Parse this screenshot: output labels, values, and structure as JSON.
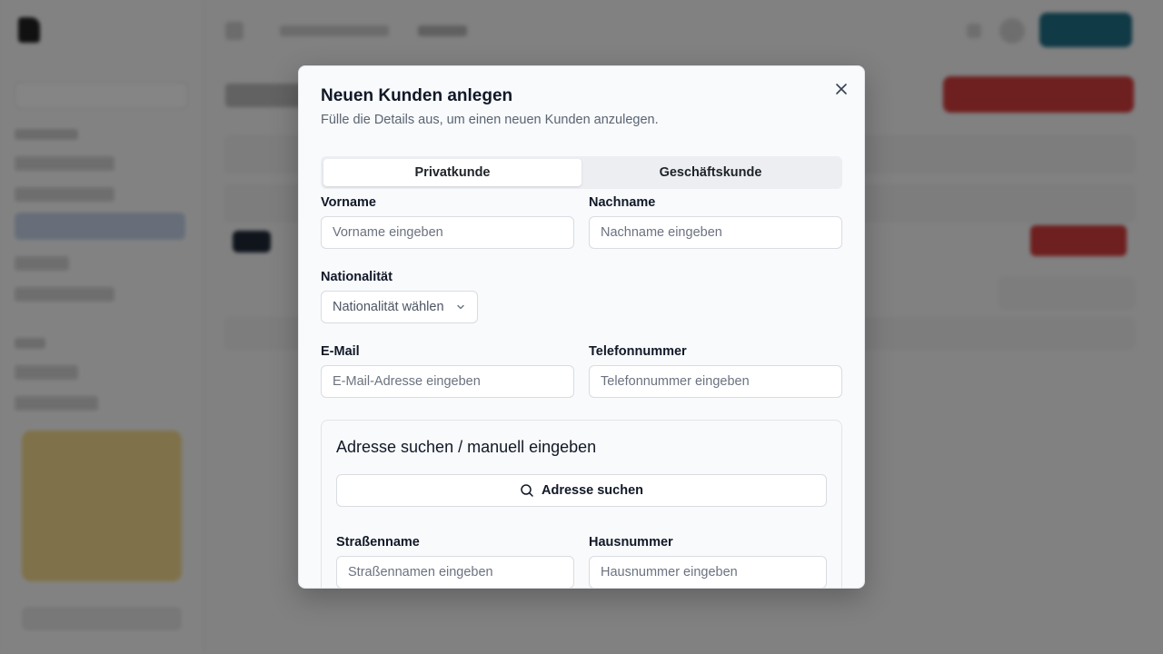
{
  "modal": {
    "title": "Neuen Kunden anlegen",
    "description": "Fülle die Details aus, um einen neuen Kunden anzulegen.",
    "tabs": [
      {
        "label": "Privatkunde",
        "active": true
      },
      {
        "label": "Geschäftskunde",
        "active": false
      }
    ],
    "fields": {
      "first_name": {
        "label": "Vorname",
        "placeholder": "Vorname eingeben"
      },
      "last_name": {
        "label": "Nachname",
        "placeholder": "Nachname eingeben"
      },
      "nationality": {
        "label": "Nationalität",
        "placeholder": "Nationalität wählen"
      },
      "email": {
        "label": "E-Mail",
        "placeholder": "E-Mail-Adresse eingeben"
      },
      "phone": {
        "label": "Telefonnummer",
        "placeholder": "Telefonnummer eingeben"
      }
    },
    "address": {
      "title": "Adresse suchen / manuell eingeben",
      "search_button": "Adresse suchen",
      "street": {
        "label": "Straßenname",
        "placeholder": "Straßennamen eingeben"
      },
      "house_number": {
        "label": "Hausnummer",
        "placeholder": "Hausnummer eingeben"
      }
    }
  },
  "colors": {
    "overlay": "#000000",
    "accent_teal": "#1f6f86",
    "danger_red": "#d43c3c"
  }
}
